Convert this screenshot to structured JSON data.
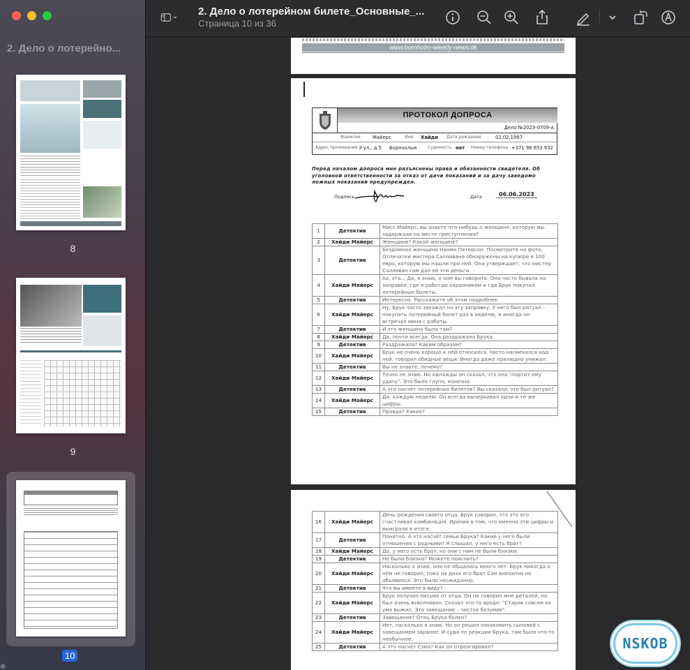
{
  "sidebar": {
    "title": "2. Дело о лотерейно...",
    "thumbnails": [
      {
        "page": "8"
      },
      {
        "page": "9"
      },
      {
        "page": "10"
      }
    ]
  },
  "toolbar": {
    "doc_title": "2. Дело о лотерейном билете_Основные_...",
    "doc_subtitle": "Страница 10 из 36"
  },
  "page_top": {
    "footer_url": "www.bornholm-weekly-news.dk"
  },
  "form": {
    "title": "ПРОТОКОЛ ДОПРОСА",
    "case_no": "Дело №2023-0709-А",
    "surname_label": "Фамилия",
    "surname": "Майерс",
    "name_label": "Имя",
    "name": "Хайди",
    "dob_label": "Дата рождения",
    "dob": "02.02.1997",
    "address_label": "Адрес проживания",
    "address": "3-ул., д.5",
    "city": "Борнхольм",
    "record_label": "Судимость",
    "record": "нет",
    "phone_label": "Номер телефона",
    "phone": "+371 98 653 932",
    "notice": "Перед началом допроса мне разъяснены права и обязанности свидетеля. Об уголовной ответственности за отказ от дачи показаний и за дачу заведомо ложных показаний предупрежден.",
    "sign_label": "Подпись",
    "date_label": "Дата",
    "date": "06.06.2023"
  },
  "rows1": [
    {
      "n": "1",
      "s": "Детектив",
      "t": "Мисс Майерс, вы знаете что-нибудь о женщине, которую мы задержали на месте преступления?"
    },
    {
      "n": "2",
      "s": "Хайди Майерс",
      "t": "Женщине? Какой женщине?"
    },
    {
      "n": "3",
      "s": "Детектив",
      "t": "Бездомная женщина Наоми Петерсон. Посмотрите на фото. Отпечатки мистера Салливана обнаружены на купюре в 100 евро, которую мы нашли при ней. Она утверждает, что мистер Салливан сам дал ей эти деньги."
    },
    {
      "n": "4",
      "s": "Хайди Майерс",
      "t": "Ах, эта... Да, я знаю, о ком вы говорите. Она часто бывала на заправке, где я работаю охранником и где Брук покупал лотерейные билеты."
    },
    {
      "n": "5",
      "s": "Детектив",
      "t": "Интересно. Расскажите об этом подробнее."
    },
    {
      "n": "6",
      "s": "Хайди Майерс",
      "t": "Ну, Брук часто заезжал на эту заправку. У него был ритуал – покупать лотерейный билет раз в неделю, и иногда он встречал меня с работы."
    },
    {
      "n": "7",
      "s": "Детектив",
      "t": "И эта женщина была там?"
    },
    {
      "n": "8",
      "s": "Хайди Майерс",
      "t": "Да, почти всегда. Она раздражала Брука."
    },
    {
      "n": "9",
      "s": "Детектив",
      "t": "Раздражала? Каким образом?"
    },
    {
      "n": "10",
      "s": "Хайди Майерс",
      "t": "Брук не очень хорошо к ней относился. Часто насмехался над ней, говорил обидные вещи. Иногда даже прилюдно унижал."
    },
    {
      "n": "11",
      "s": "Детектив",
      "t": "Вы не знаете, почему?"
    },
    {
      "n": "12",
      "s": "Хайди Майерс",
      "t": "Точно не знаю. Но однажды он сказал, что она \"портит ему удачу\". Это было глупо, конечно."
    },
    {
      "n": "13",
      "s": "Детектив",
      "t": "А что насчёт лотерейных билетов? Вы сказали, это был ритуал?"
    },
    {
      "n": "14",
      "s": "Хайди Майерс",
      "t": "Да, каждую неделю. Он всегда вычеркивал одни и те же цифры."
    },
    {
      "n": "15",
      "s": "Детектив",
      "t": "Правда? Какие?"
    }
  ],
  "rows2": [
    {
      "n": "16",
      "s": "Хайди Майерс",
      "t": "День рождения своего отца. Брук говорил, что это его счастливая комбинация. Ирония в том, что именно эти цифры и выиграли в итоге."
    },
    {
      "n": "17",
      "s": "Детектив",
      "t": "Понятно. А что насчёт семьи Брука? Какие у него были отношения с родными? Я слышал, у него есть брат?"
    },
    {
      "n": "18",
      "s": "Хайди Майерс",
      "t": "Да, у него есть брат, но они с ним не были близки."
    },
    {
      "n": "19",
      "s": "Детектив",
      "t": "Не были близки? Можете пояснить?"
    },
    {
      "n": "20",
      "s": "Хайди Майерс",
      "t": "Насколько я знаю, они не общались много лет. Брук никогда о нём не говорил, пока на днях его брат Сэм внезапно не объявился. Это было неожиданно."
    },
    {
      "n": "21",
      "s": "Детектив",
      "t": "Что вы имеете в виду?"
    },
    {
      "n": "22",
      "s": "Хайди Майерс",
      "t": "Брук получил письмо от отца. Он не говорил мне деталей, но был очень взволнован. Сказал что-то вроде: \"Старик совсем из ума выжил. Это завещание – чистое безумие\"."
    },
    {
      "n": "23",
      "s": "Детектив",
      "t": "Завещание? Отец Брука болен?"
    },
    {
      "n": "24",
      "s": "Хайди Майерс",
      "t": "Нет, насколько я знаю. Но он решил ознакомить сыновей с завещанием заранее. И судя по реакции Брука, там было что-то необычное."
    },
    {
      "n": "25",
      "s": "Детектив",
      "t": "А что насчёт Сэма? Как он отреагировал?"
    }
  ],
  "watermark": "NSKOB"
}
